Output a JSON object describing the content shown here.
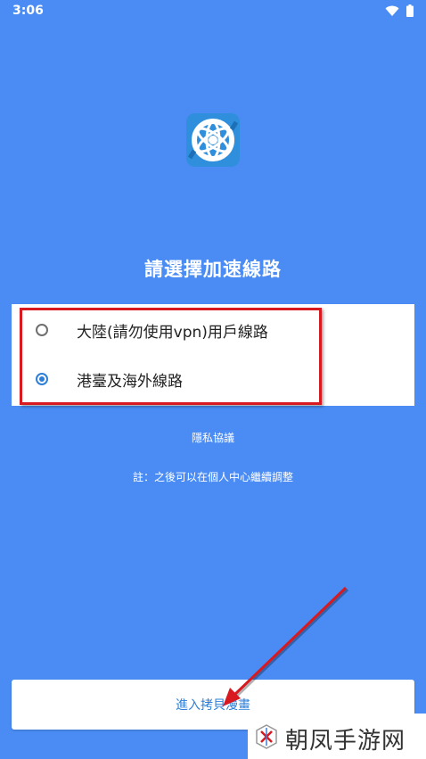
{
  "status_bar": {
    "time": "3:06"
  },
  "page": {
    "title": "請選擇加速線路"
  },
  "options": [
    {
      "label": "大陸(請勿使用vpn)用戶線路",
      "selected": false
    },
    {
      "label": "港臺及海外線路",
      "selected": true
    }
  ],
  "privacy_link": "隱私協議",
  "note": "註：之後可以在個人中心繼續調整",
  "enter_button": "進入拷貝漫畫",
  "watermark": {
    "text": "朝凤手游网"
  },
  "colors": {
    "background": "#4a8cf4",
    "accent": "#2f7fd8",
    "annotation": "#d8191f"
  }
}
